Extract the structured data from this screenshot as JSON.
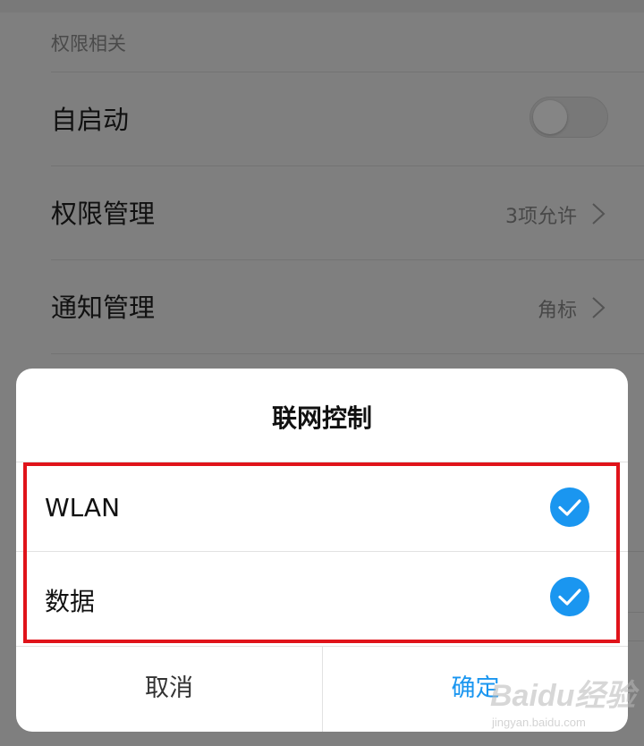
{
  "settings": {
    "section_header": "权限相关",
    "rows": [
      {
        "label": "自启动",
        "toggle_on": false
      },
      {
        "label": "权限管理",
        "value": "3项允许"
      },
      {
        "label": "通知管理",
        "value": "角标"
      }
    ]
  },
  "dialog": {
    "title": "联网控制",
    "options": [
      {
        "label": "WLAN",
        "checked": true
      },
      {
        "label": "数据",
        "checked": true
      }
    ],
    "cancel_label": "取消",
    "confirm_label": "确定"
  },
  "watermark": {
    "logo_text": "Baidu经验",
    "url_text": "jingyan.baidu.com"
  },
  "colors": {
    "accent": "#1a96f0",
    "highlight": "#e0131a"
  }
}
